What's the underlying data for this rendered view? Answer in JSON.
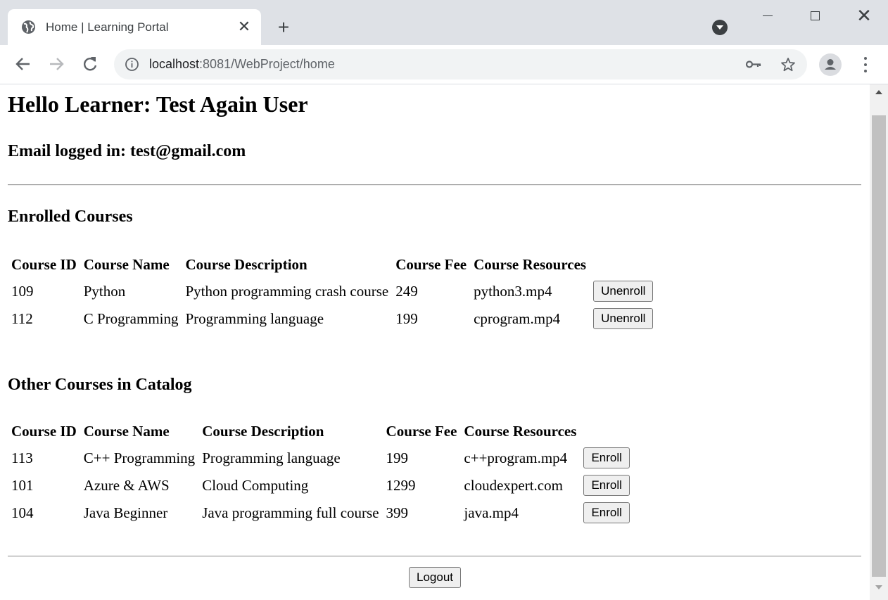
{
  "browser": {
    "tab": {
      "title": "Home | Learning Portal",
      "close_glyph": "✕",
      "favicon": "globe-icon"
    },
    "new_tab_glyph": "+",
    "window_close_glyph": "✕",
    "url_host": "localhost",
    "url_rest": ":8081/WebProject/home"
  },
  "page": {
    "greeting": "Hello Learner: Test Again User",
    "email_line": "Email logged in: test@gmail.com",
    "enrolled": {
      "title": "Enrolled Courses",
      "headers": [
        "Course ID",
        "Course Name",
        "Course Description",
        "Course Fee",
        "Course Resources"
      ],
      "rows": [
        {
          "id": "109",
          "name": "Python",
          "description": "Python programming crash course",
          "fee": "249",
          "resource": "python3.mp4",
          "action": "Unenroll"
        },
        {
          "id": "112",
          "name": "C Programming",
          "description": "Programming language",
          "fee": "199",
          "resource": "cprogram.mp4",
          "action": "Unenroll"
        }
      ]
    },
    "catalog": {
      "title": "Other Courses in Catalog",
      "headers": [
        "Course ID",
        "Course Name",
        "Course Description",
        "Course Fee",
        "Course Resources"
      ],
      "rows": [
        {
          "id": "113",
          "name": "C++ Programming",
          "description": "Programming language",
          "fee": "199",
          "resource": "c++program.mp4",
          "action": "Enroll"
        },
        {
          "id": "101",
          "name": "Azure & AWS",
          "description": "Cloud Computing",
          "fee": "1299",
          "resource": "cloudexpert.com",
          "action": "Enroll"
        },
        {
          "id": "104",
          "name": "Java Beginner",
          "description": "Java programming full course",
          "fee": "399",
          "resource": "java.mp4",
          "action": "Enroll"
        }
      ]
    },
    "logout_label": "Logout"
  }
}
